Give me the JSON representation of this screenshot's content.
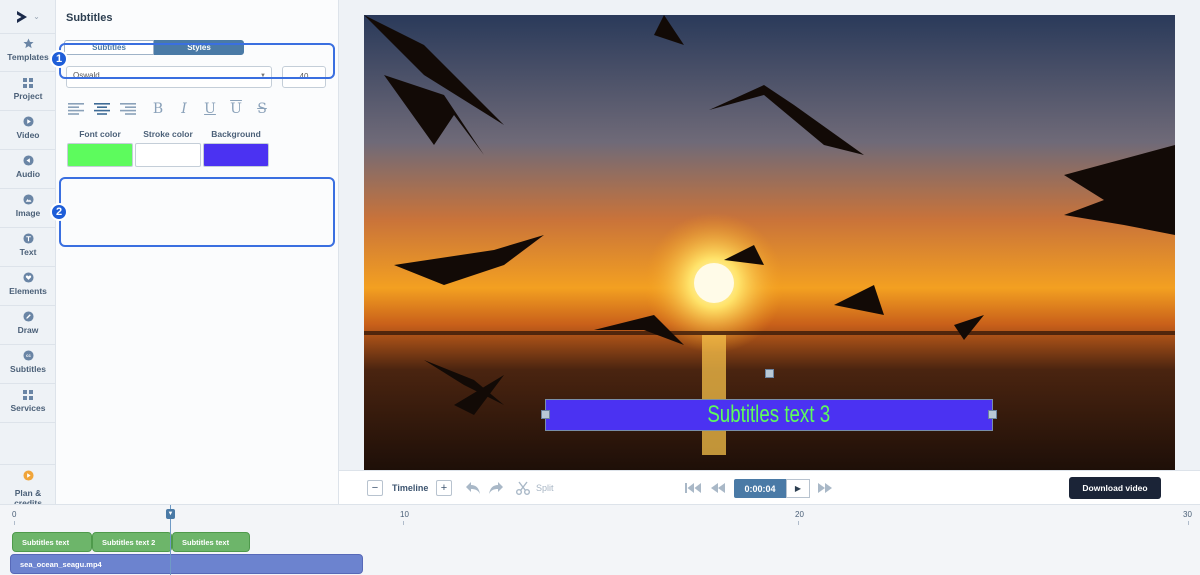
{
  "sidebar": {
    "items": [
      {
        "label": "Templates",
        "icon": "star-icon"
      },
      {
        "label": "Project",
        "icon": "grid-icon"
      },
      {
        "label": "Video",
        "icon": "play-circle-icon"
      },
      {
        "label": "Audio",
        "icon": "audio-icon"
      },
      {
        "label": "Image",
        "icon": "image-icon"
      },
      {
        "label": "Text",
        "icon": "text-icon"
      },
      {
        "label": "Elements",
        "icon": "heart-icon"
      },
      {
        "label": "Draw",
        "icon": "pencil-icon"
      },
      {
        "label": "Subtitles",
        "icon": "cc-icon"
      },
      {
        "label": "Services",
        "icon": "services-grid-icon"
      }
    ],
    "plan_label_line1": "Plan &",
    "plan_label_line2": "credits"
  },
  "panel": {
    "title": "Subtitles",
    "tabs": [
      {
        "label": "Subtitles",
        "active": false
      },
      {
        "label": "Styles",
        "active": true
      }
    ],
    "font_value": "Oswald",
    "font_size": "40",
    "colors": [
      {
        "label": "Font color",
        "hex": "#5dfb5d"
      },
      {
        "label": "Stroke color",
        "hex": "#ffffff"
      },
      {
        "label": "Background",
        "hex": "#4b32f2"
      }
    ],
    "markers": [
      "1",
      "2"
    ]
  },
  "preview": {
    "subtitle_text": "Subtitles text 3",
    "subtitle_color": "#5dfb5d",
    "subtitle_bg": "#4b32f2"
  },
  "toolbar": {
    "timeline_label": "Timeline",
    "minus": "−",
    "plus": "+",
    "split_label": "Split",
    "time": "0:00:04",
    "download_label": "Download video"
  },
  "timeline": {
    "ruler": [
      "0",
      "10",
      "20",
      "30"
    ],
    "subtitle_clips": [
      "Subtitles text",
      "Subtitles text 2",
      "Subtitles text"
    ],
    "video_clip": "sea_ocean_seagu.mp4"
  }
}
